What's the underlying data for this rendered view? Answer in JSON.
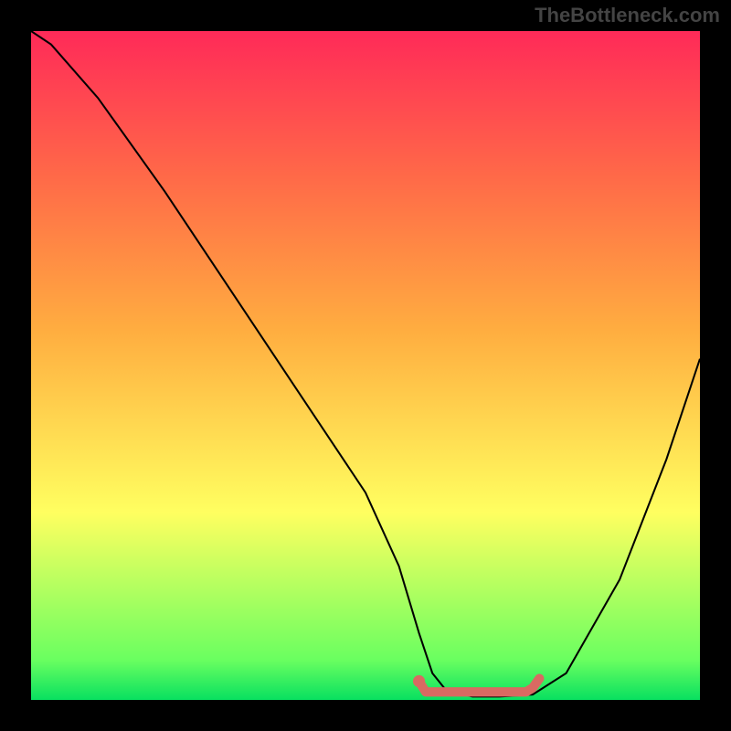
{
  "watermark": "TheBottleneck.com",
  "chart_data": {
    "type": "line",
    "title": "",
    "xlabel": "",
    "ylabel": "",
    "xlim": [
      0,
      100
    ],
    "ylim": [
      0,
      100
    ],
    "grid": false,
    "series": [
      {
        "name": "curve",
        "color": "#000000",
        "x": [
          0,
          3,
          10,
          20,
          30,
          40,
          50,
          55,
          58,
          60,
          62,
          66,
          70,
          75,
          80,
          88,
          95,
          100
        ],
        "y": [
          100,
          98,
          90,
          76,
          61,
          46,
          31,
          20,
          10,
          4,
          1.5,
          0.5,
          0.5,
          0.8,
          4,
          18,
          36,
          51
        ]
      },
      {
        "name": "marker-segment",
        "color": "#d96a62",
        "x": [
          58,
          59,
          62,
          68,
          72,
          74,
          75,
          76
        ],
        "y": [
          2.8,
          1.2,
          1.2,
          1.2,
          1.2,
          1.2,
          1.8,
          3.2
        ]
      }
    ],
    "marker_dot": {
      "x": 58,
      "y": 2.8,
      "color": "#d96a62"
    }
  }
}
